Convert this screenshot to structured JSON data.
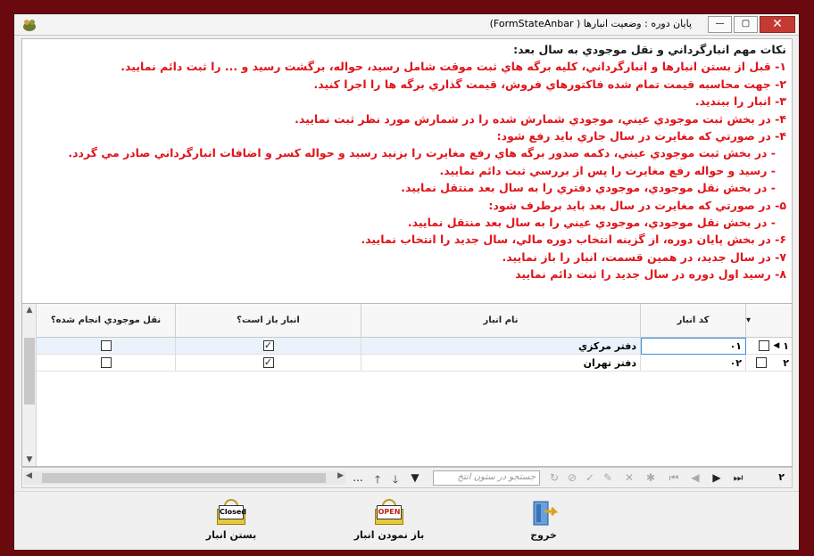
{
  "window": {
    "title": "پایان دوره : وضعیت انبارها ( FormStateAnbar)",
    "minimize_glyph": "—",
    "maximize_glyph": "▢",
    "close_glyph": "✕"
  },
  "notes": [
    {
      "text": "نكات مهم انبارگرداني و نقل موجودي به سال بعد:",
      "color": "dark",
      "indent": false
    },
    {
      "text": "۱- قبل از بستن انبارها و انبارگرداني، كليه برگه هاي ثبت موقت شامل رسيد، حواله، برگشت رسيد و ... را ثبت دائم نماييد.",
      "color": "red",
      "indent": false
    },
    {
      "text": "۲- جهت محاسبه قيمت تمام شده فاكتورهاي فروش، قيمت گذاري برگه ها را اجرا كنيد.",
      "color": "red",
      "indent": false
    },
    {
      "text": "۳- انبار را ببنديد.",
      "color": "red",
      "indent": false
    },
    {
      "text": "۴- در بخش ثبت موجودي عيني، موجودي شمارش شده را در شمارش مورد نظر ثبت نماييد.",
      "color": "red",
      "indent": false
    },
    {
      "text": "۴- در صورتي كه مغايرت در سال جاري بايد رفع شود:",
      "color": "red",
      "indent": false
    },
    {
      "text": "-  در بخش ثبت موجودي عيني، دكمه صدور برگه هاي رفع مغايرت را بزنيد رسيد و حواله كسر و اضافات انبارگرداني صادر مي گردد.",
      "color": "red",
      "indent": true
    },
    {
      "text": "-  رسيد و حواله رفع مغايرت را پس از بررسي ثبت دائم نماييد.",
      "color": "red",
      "indent": true
    },
    {
      "text": "-  در بخش نقل موجودي، موجودي دفتري را به سال بعد منتقل نماييد.",
      "color": "red",
      "indent": true
    },
    {
      "text": "۵- در صورتي كه مغايرت در سال بعد بايد برطرف شود:",
      "color": "red",
      "indent": false
    },
    {
      "text": "-  در بخش نقل موجودي، موجودي عيني را به سال بعد منتقل نماييد.",
      "color": "red",
      "indent": true
    },
    {
      "text": "۶- در بخش پايان دوره، از گزينه انتخاب دوره مالي، سال جديد را انتخاب نماييد.",
      "color": "red",
      "indent": false
    },
    {
      "text": "۷- در سال جديد، در همين قسمت، انبار را باز نماييد.",
      "color": "red",
      "indent": false
    },
    {
      "text": "۸- رسيد اول دوره در سال جديد را ثبت دائم نماييد",
      "color": "red",
      "indent": false
    }
  ],
  "grid": {
    "columns": [
      "كد انبار",
      "نام انبار",
      "انبار باز است؟",
      "نقل موجودي انجام شده؟"
    ],
    "rows": [
      {
        "num": "۱",
        "code": "۰۱",
        "name": "دفتر مركزي",
        "open": "✓",
        "transferred": ""
      },
      {
        "num": "۲",
        "code": "۰۲",
        "name": "دفتر تهران",
        "open": "✓",
        "transferred": ""
      }
    ]
  },
  "toolbar": {
    "search_placeholder": "جستجو در ستون انتخ",
    "row_count": "۲",
    "more_glyph": "..."
  },
  "buttons": {
    "close_warehouse": "بستن انبار",
    "open_warehouse": "باز نمودن انبار",
    "exit": "خروج",
    "closed_sign": "Closed",
    "open_sign": "OPEN"
  },
  "colors": {
    "note_red": "#e0141a",
    "note_dark": "#1a1a1a",
    "background": "#6b0a0e",
    "selection": "#3a8ee6"
  }
}
